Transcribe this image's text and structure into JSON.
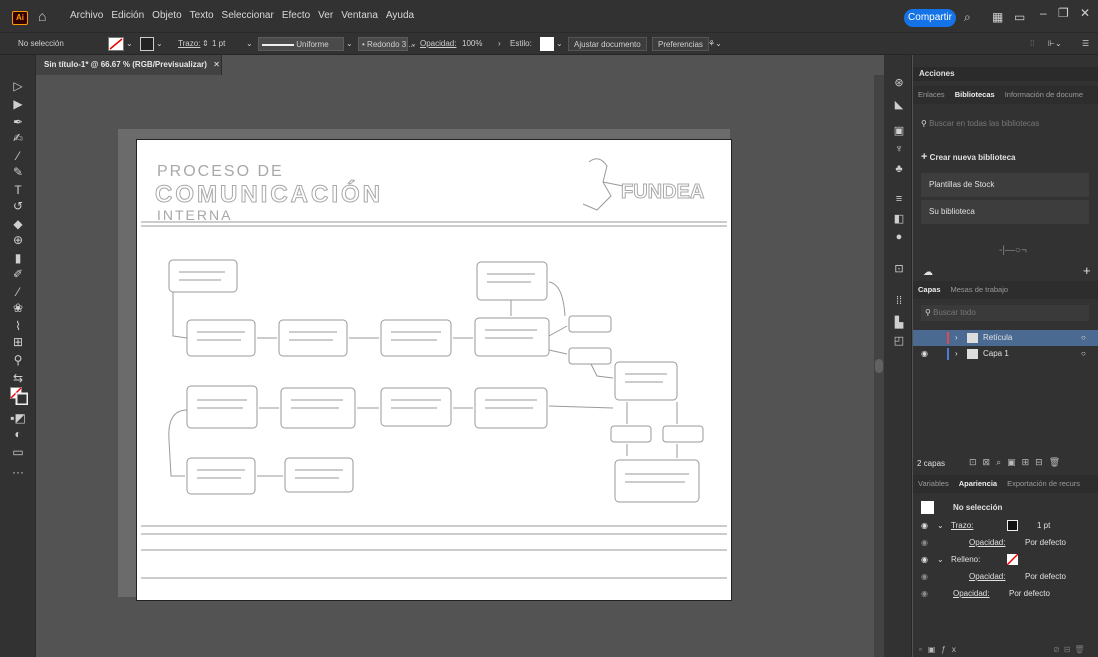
{
  "menubar": {
    "logo": "Ai",
    "menus": [
      "Archivo",
      "Edición",
      "Objeto",
      "Texto",
      "Seleccionar",
      "Efecto",
      "Ver",
      "Ventana",
      "Ayuda"
    ],
    "share_label": "Compartir"
  },
  "controlbar": {
    "selection_status": "No selección",
    "stroke_label": "Trazo:",
    "stroke_value": "1 pt",
    "stroke_profile": "Uniforme",
    "brush": "Redondo 3 ...",
    "opacity_label": "Opacidad:",
    "opacity_value": "100%",
    "style_label": "Estilo:",
    "fit_document_button": "Ajustar documento",
    "preferences_button": "Preferencias"
  },
  "document": {
    "tab_title": "Sin título-1* @ 66.67 % (RGB/Previsualizar)",
    "artboard": {
      "title_line1": "PROCESO DE",
      "title_line2": "COMUNICACIÓN",
      "title_line3": "INTERNA",
      "logo_text": "FUNDEA"
    }
  },
  "panels": {
    "actions_title": "Acciones",
    "libraries_tabs": [
      "Enlaces",
      "Bibliotecas",
      "Información de docume"
    ],
    "libraries_active_tab": "Bibliotecas",
    "libraries_search_placeholder": "Buscar en todas las bibliotecas",
    "create_library": "Crear nueva biblioteca",
    "library_items": [
      "Plantillas de Stock",
      "Su biblioteca"
    ],
    "layers_tabs": [
      "Capas",
      "Mesas de trabajo"
    ],
    "layers_search_placeholder": "Buscar todo",
    "layers": [
      {
        "name": "Retícula"
      },
      {
        "name": "Capa 1"
      }
    ],
    "layers_count": "2 capas",
    "appearance_tabs": [
      "Variables",
      "Apariencia",
      "Exportación de recurs"
    ],
    "appearance_active_tab": "Apariencia",
    "appearance": {
      "header": "No selección",
      "stroke_label": "Trazo:",
      "stroke_value": "1 pt",
      "stroke_opacity_label": "Opacidad:",
      "stroke_opacity_value": "Por defecto",
      "fill_label": "Relleno:",
      "fill_opacity_label": "Opacidad:",
      "fill_opacity_value": "Por defecto",
      "opacity_label": "Opacidad:",
      "opacity_value": "Por defecto"
    }
  },
  "colors": {
    "share_button": "#1473e6",
    "selected_layer": "#4b6a92",
    "layer_retícula_color": "#e34850",
    "layer_capa1_color": "#4a7bd8"
  }
}
